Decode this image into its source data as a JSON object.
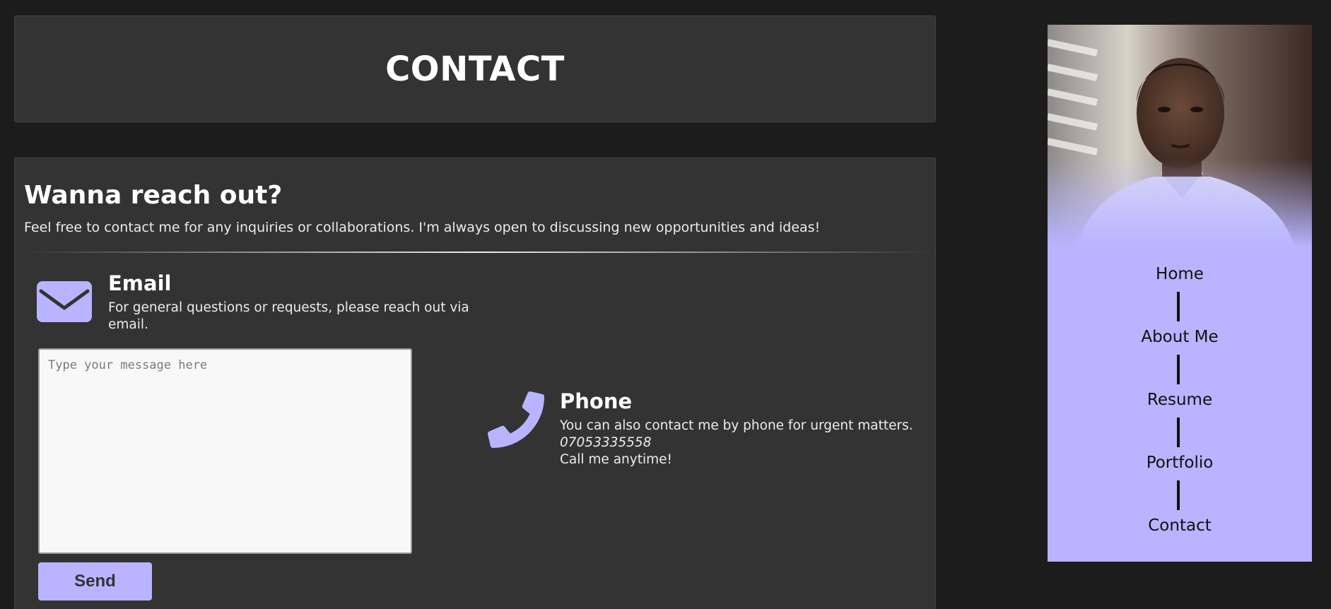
{
  "header": {
    "title": "CONTACT"
  },
  "contact": {
    "heading": "Wanna reach out?",
    "intro": "Feel free to contact me for any inquiries or collaborations. I'm always open to discussing new opportunities and ideas!",
    "email": {
      "icon": "envelope-icon",
      "title": "Email",
      "description": "For general questions or requests, please reach out via email."
    },
    "message": {
      "placeholder": "Type your message here",
      "value": ""
    },
    "send_label": "Send",
    "phone": {
      "icon": "phone-icon",
      "title": "Phone",
      "description": "You can also contact me by phone for urgent matters.",
      "number": "07053335558",
      "note": "Call me anytime!"
    }
  },
  "sidebar": {
    "nav": [
      {
        "label": "Home"
      },
      {
        "label": "About Me"
      },
      {
        "label": "Resume"
      },
      {
        "label": "Portfolio"
      },
      {
        "label": "Contact"
      }
    ]
  },
  "colors": {
    "background": "#1c1c1c",
    "card": "#333333",
    "accent": "#b8b4ff",
    "text": "#f2f2f2"
  }
}
